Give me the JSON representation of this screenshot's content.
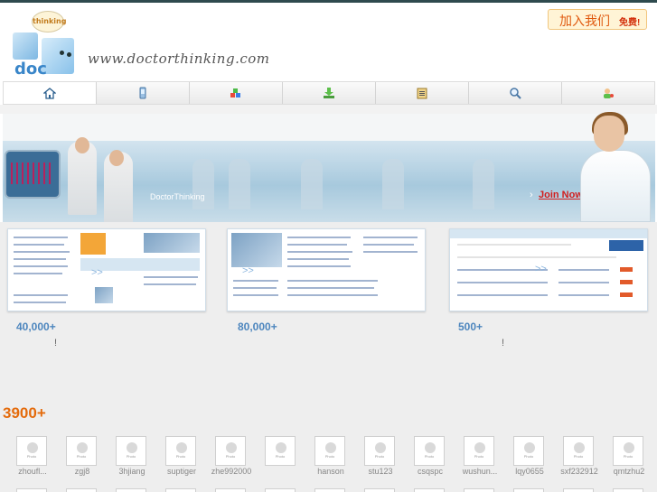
{
  "header": {
    "logo_badge": "thinking",
    "logo_text": "doc",
    "url": "www.doctorthinking.com",
    "join_label": "加入我们",
    "join_free": "免费!"
  },
  "nav": {
    "tabs": [
      {
        "icon": "home-icon"
      },
      {
        "icon": "mobile-icon"
      },
      {
        "icon": "blocks-icon"
      },
      {
        "icon": "download-icon"
      },
      {
        "icon": "clipboard-icon"
      },
      {
        "icon": "search-icon"
      },
      {
        "icon": "contact-icon"
      }
    ]
  },
  "banner": {
    "caption": "DoctorThinking",
    "join_now": "Join Nows",
    "arrow": "›"
  },
  "stats": [
    {
      "value": "40,000+",
      "note": "!"
    },
    {
      "value": "80,000+",
      "note": ""
    },
    {
      "value": "500+",
      "note": "!"
    }
  ],
  "members": {
    "count": "3900+",
    "photo_text": "Photo",
    "names": [
      "zhoufl...",
      "zgj8",
      "3hjiang",
      "suptiger",
      "zhe992000",
      "",
      "hanson",
      "stu123",
      "csqspc",
      "wushun...",
      "lqy0655",
      "sxf232912",
      "qmtzhu2"
    ]
  },
  "colors": {
    "accent_orange": "#e46b0c",
    "stat_blue": "#4d86be",
    "join_red": "#d21c1c"
  }
}
